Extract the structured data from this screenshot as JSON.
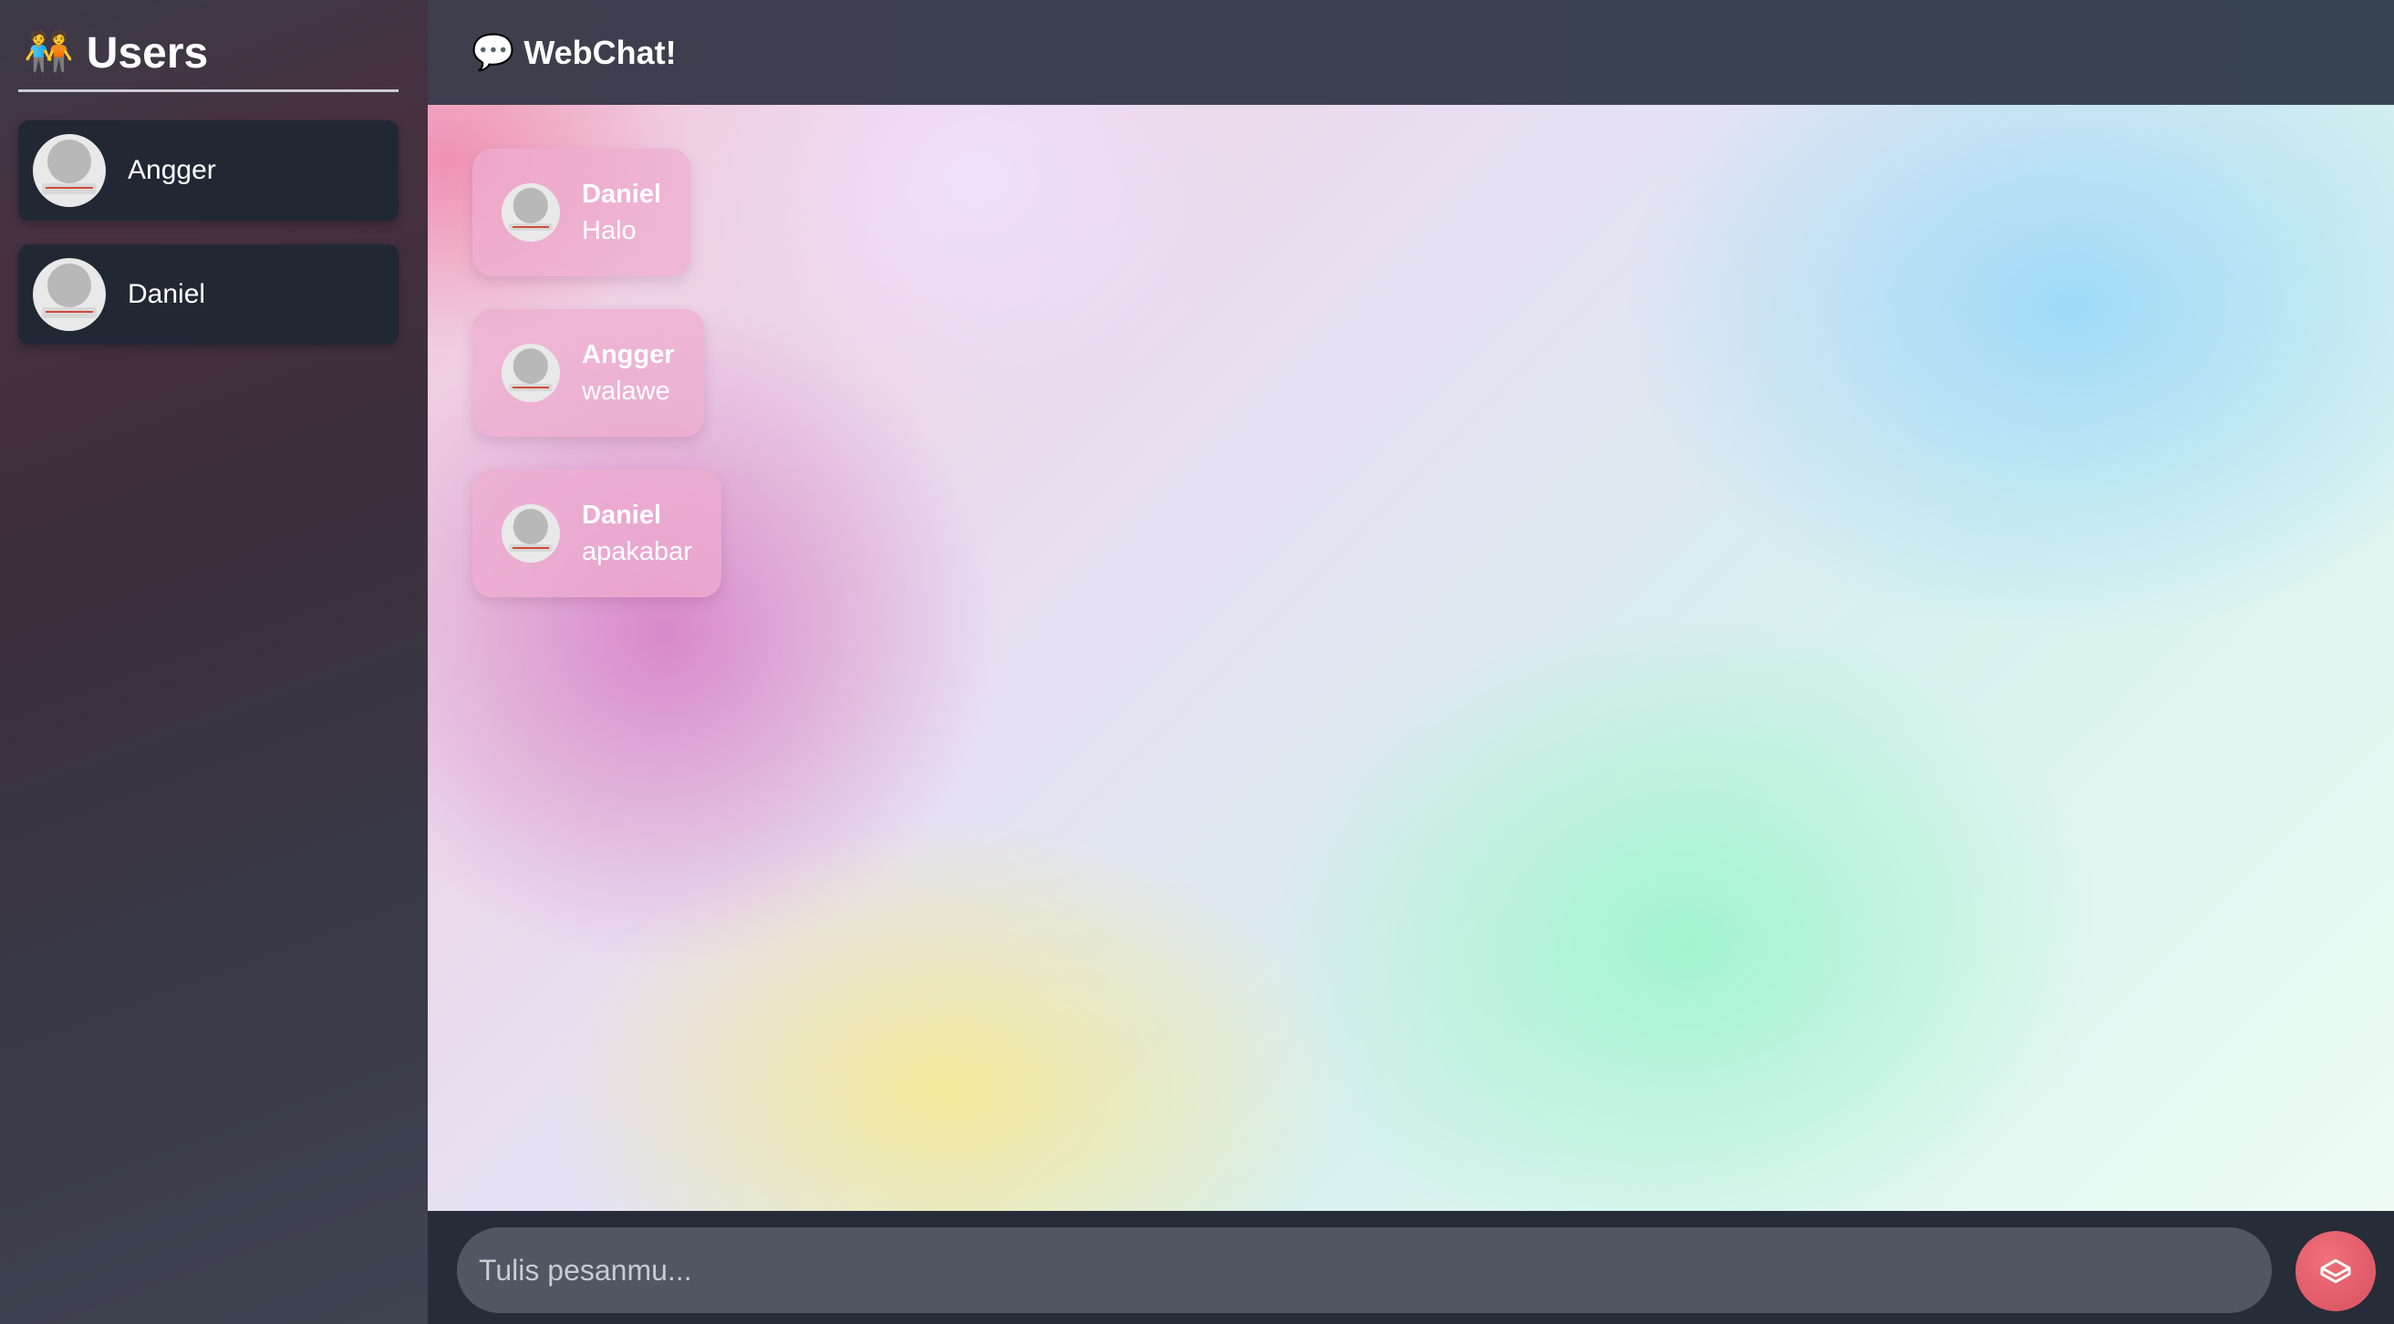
{
  "sidebar": {
    "title": "Users",
    "title_icon": "people-holding-hands-icon",
    "title_emoji": "🧑‍🤝‍🧑",
    "users": [
      {
        "name": "Angger"
      },
      {
        "name": "Daniel"
      }
    ]
  },
  "header": {
    "title": "WebChat!",
    "icon": "speech-bubble-icon",
    "icon_emoji": "💬"
  },
  "messages": [
    {
      "sender": "Daniel",
      "text": "Halo"
    },
    {
      "sender": "Angger",
      "text": "walawe"
    },
    {
      "sender": "Daniel",
      "text": "apakabar"
    }
  ],
  "composer": {
    "placeholder": "Tulis pesanmu...",
    "value": "",
    "send_icon": "send-icon"
  },
  "colors": {
    "sidebar_card": "#212834",
    "send_button": "#e0606c",
    "message_bubble": "#eeacce"
  }
}
